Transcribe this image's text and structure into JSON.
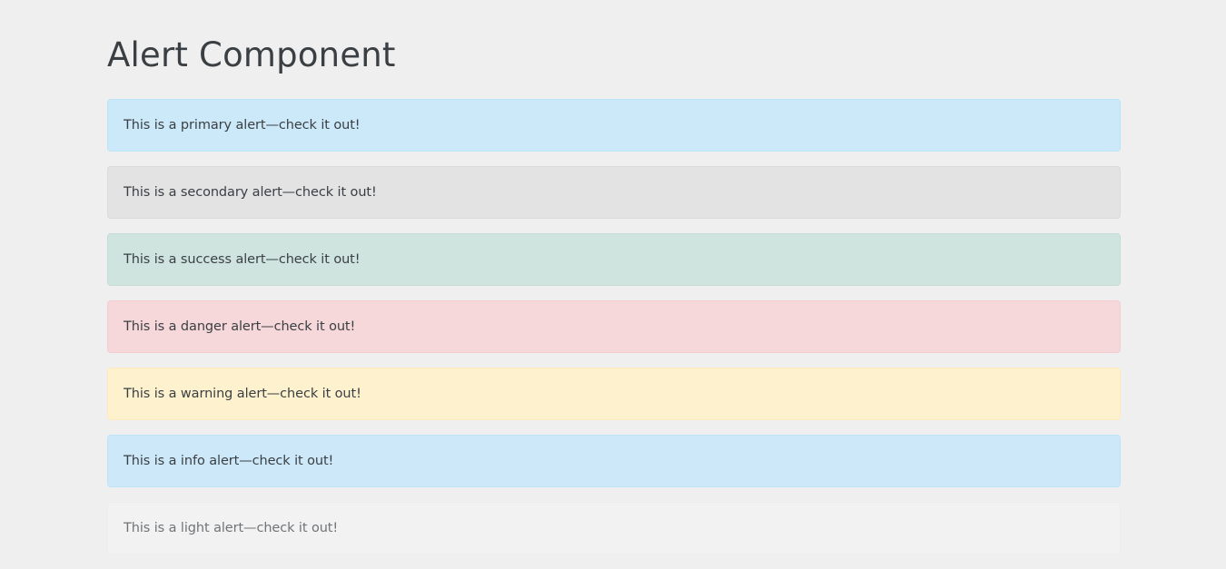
{
  "page": {
    "title": "Alert Component"
  },
  "alerts": [
    {
      "variant": "primary",
      "text": "This is a primary alert—check it out!",
      "background": "#cce9f9",
      "border": "#bde3f7",
      "color": "#3a3f44"
    },
    {
      "variant": "secondary",
      "text": "This is a secondary alert—check it out!",
      "background": "#e3e3e4",
      "border": "#dadadb",
      "color": "#3a3f44"
    },
    {
      "variant": "success",
      "text": "This is a success alert—check it out!",
      "background": "#cfe4de",
      "border": "#c4ded6",
      "color": "#3a3f44"
    },
    {
      "variant": "danger",
      "text": "This is a danger alert—check it out!",
      "background": "#f7d8da",
      "border": "#f3ccd0",
      "color": "#3a3f44"
    },
    {
      "variant": "warning",
      "text": "This is a warning alert—check it out!",
      "background": "#fef1cd",
      "border": "#fde9bd",
      "color": "#3a3f44"
    },
    {
      "variant": "info",
      "text": "This is a info alert—check it out!",
      "background": "#cde9f9",
      "border": "#bee3f7",
      "color": "#3a3f44"
    },
    {
      "variant": "light",
      "text": "This is a light alert—check it out!",
      "background": "#f2f2f2",
      "border": "#ececec",
      "color": "#707478"
    }
  ]
}
